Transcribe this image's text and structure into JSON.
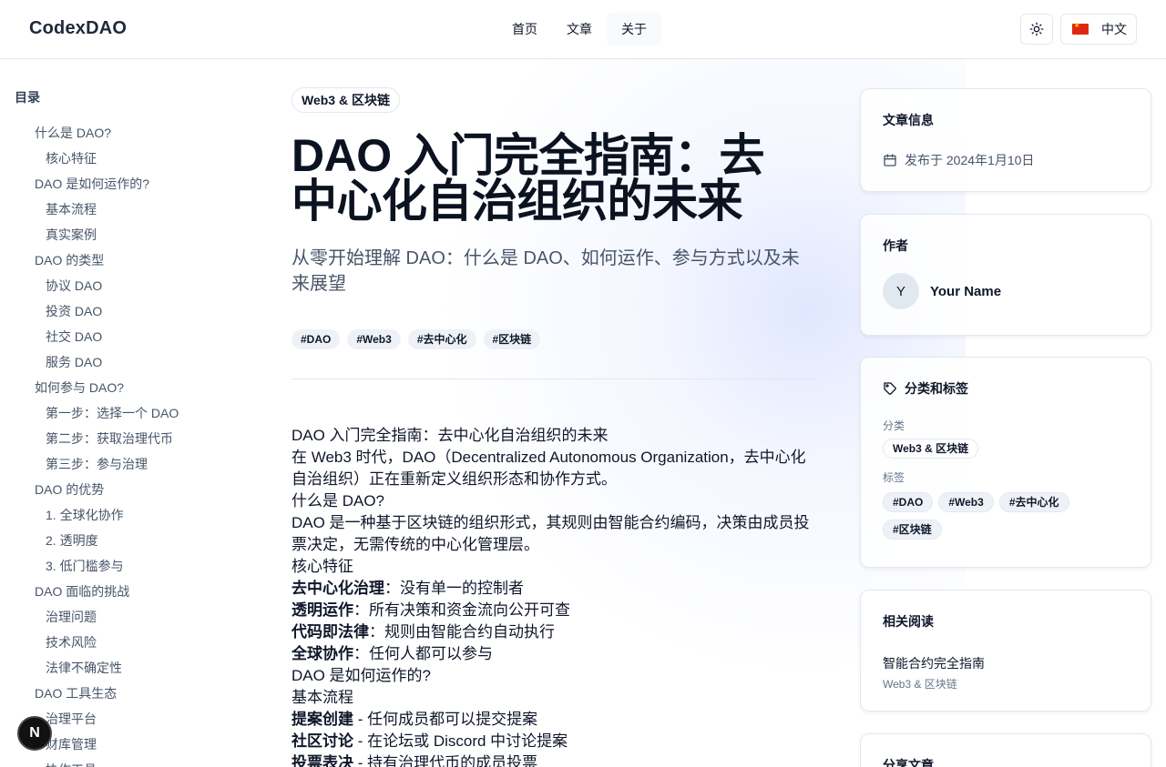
{
  "header": {
    "logo": "CodexDAO",
    "nav": [
      "首页",
      "文章",
      "关于"
    ],
    "theme_icon": "sun-icon",
    "language": "中文"
  },
  "toc": {
    "title": "目录",
    "items": [
      {
        "label": "什么是 DAO?",
        "level": 1
      },
      {
        "label": "核心特征",
        "level": 2
      },
      {
        "label": "DAO 是如何运作的?",
        "level": 1
      },
      {
        "label": "基本流程",
        "level": 2
      },
      {
        "label": "真实案例",
        "level": 2
      },
      {
        "label": "DAO 的类型",
        "level": 1
      },
      {
        "label": "协议 DAO",
        "level": 2
      },
      {
        "label": "投资 DAO",
        "level": 2
      },
      {
        "label": "社交 DAO",
        "level": 2
      },
      {
        "label": "服务 DAO",
        "level": 2
      },
      {
        "label": "如何参与 DAO?",
        "level": 1
      },
      {
        "label": "第一步：选择一个 DAO",
        "level": 2
      },
      {
        "label": "第二步：获取治理代币",
        "level": 2
      },
      {
        "label": "第三步：参与治理",
        "level": 2
      },
      {
        "label": "DAO 的优势",
        "level": 1
      },
      {
        "label": "1. 全球化协作",
        "level": 2
      },
      {
        "label": "2. 透明度",
        "level": 2
      },
      {
        "label": "3. 低门槛参与",
        "level": 2
      },
      {
        "label": "DAO 面临的挑战",
        "level": 1
      },
      {
        "label": "治理问题",
        "level": 2
      },
      {
        "label": "技术风险",
        "level": 2
      },
      {
        "label": "法律不确定性",
        "level": 2
      },
      {
        "label": "DAO 工具生态",
        "level": 1
      },
      {
        "label": "治理平台",
        "level": 2
      },
      {
        "label": "财库管理",
        "level": 2
      },
      {
        "label": "协作工具",
        "level": 2
      }
    ]
  },
  "badge": "N",
  "article": {
    "category": "Web3 & 区块链",
    "title": "DAO 入门完全指南：去中心化自治组织的未来",
    "subtitle": "从零开始理解 DAO：什么是 DAO、如何运作、参与方式以及未来展望",
    "tags": [
      "#DAO",
      "#Web3",
      "#去中心化",
      "#区块链"
    ],
    "content": {
      "p1": "DAO 入门完全指南：去中心化自治组织的未来",
      "p2": "在 Web3 时代，DAO（Decentralized Autonomous Organization，去中心化自治组织）正在重新定义组织形态和协作方式。",
      "p3": "什么是 DAO?",
      "p4": "DAO 是一种基于区块链的组织形式，其规则由智能合约编码，决策由成员投票决定，无需传统的中心化管理层。",
      "p5": "核心特征",
      "f1_b": "去中心化治理",
      "f1_t": "：没有单一的控制者",
      "f2_b": "透明运作",
      "f2_t": "：所有决策和资金流向公开可查",
      "f3_b": "代码即法律",
      "f3_t": "：规则由智能合约自动执行",
      "f4_b": "全球协作",
      "f4_t": "：任何人都可以参与",
      "p6": "DAO 是如何运作的?",
      "p7": "基本流程",
      "s1_b": "提案创建",
      "s1_t": " - 任何成员都可以提交提案",
      "s2_b": "社区讨论",
      "s2_t": " - 在论坛或 Discord 中讨论提案",
      "s3_b": "投票表决",
      "s3_t": " - 持有治理代币的成员投票"
    }
  },
  "sidebar": {
    "info": {
      "title": "文章信息",
      "published": "发布于 2024年1月10日"
    },
    "author": {
      "title": "作者",
      "initial": "Y",
      "name": "Your Name"
    },
    "taxonomy": {
      "title": "分类和标签",
      "category_label": "分类",
      "category": "Web3 & 区块链",
      "tags_label": "标签",
      "tags": [
        "#DAO",
        "#Web3",
        "#去中心化",
        "#区块链"
      ]
    },
    "related": {
      "title": "相关阅读",
      "item_title": "智能合约完全指南",
      "item_category": "Web3 & 区块链"
    },
    "share": {
      "title": "分享文章"
    }
  }
}
